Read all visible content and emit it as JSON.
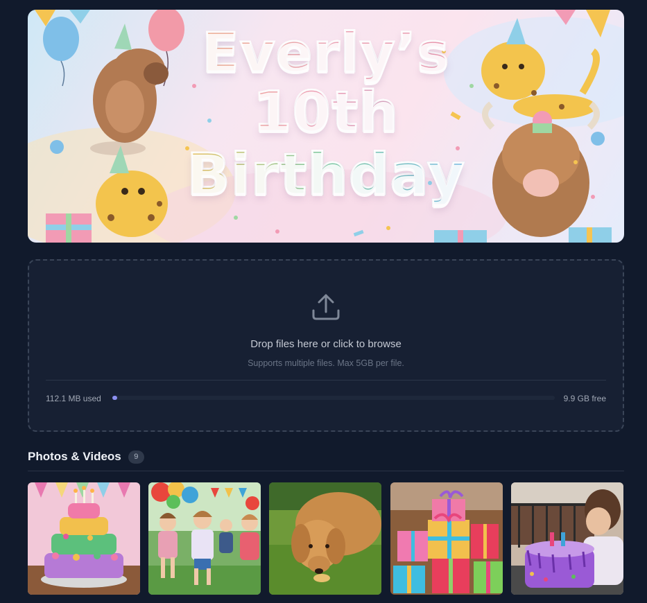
{
  "banner": {
    "line1": "Everly’s",
    "line2": "10th",
    "line3": "Birthday"
  },
  "upload": {
    "icon": "upload-icon",
    "prompt": "Drop files here or click to browse",
    "hint": "Supports multiple files. Max 5GB per file.",
    "used_label": "112.1 MB used",
    "free_label": "9.9 GB free",
    "used_fraction": 0.011,
    "accent_color": "#8b8ff0"
  },
  "gallery": {
    "title": "Photos & Videos",
    "count": "9"
  }
}
